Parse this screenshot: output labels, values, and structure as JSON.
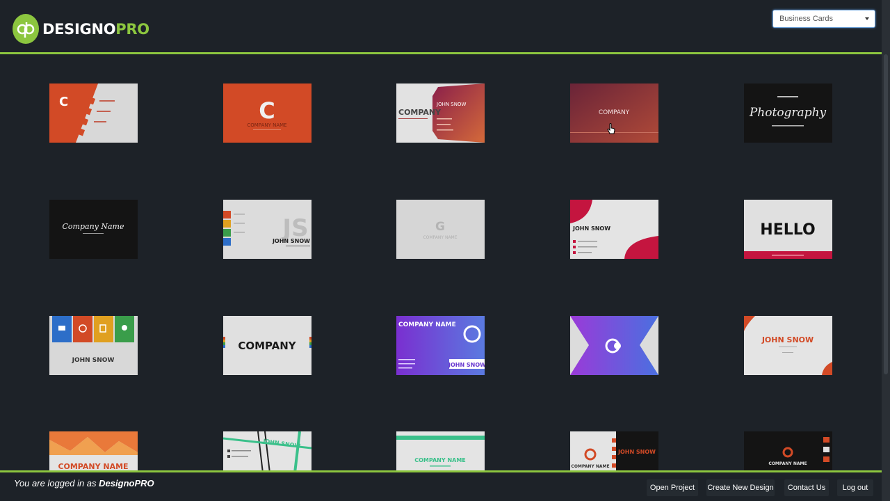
{
  "header": {
    "logo_part1": "DESIGNO",
    "logo_part2": "PRO",
    "category_select": {
      "selected": "Business Cards"
    }
  },
  "templates": [
    {
      "id": "c-orange-diagonal",
      "text": "C"
    },
    {
      "id": "company-name-orange",
      "text": "C",
      "sub": "COMPANY NAME"
    },
    {
      "id": "company-john-snow-gradient",
      "text": "COMPANY",
      "sub": "JOHN SNOW"
    },
    {
      "id": "company-maroon",
      "text": "COMPANY"
    },
    {
      "id": "photography-dark",
      "text": "Photography"
    },
    {
      "id": "company-name-script-dark",
      "text": "Company Name"
    },
    {
      "id": "js-john-snow",
      "text": "JS",
      "sub": "JOHN SNOW"
    },
    {
      "id": "g-company-name",
      "text": "G",
      "sub": "COMPANY NAME"
    },
    {
      "id": "john-snow-red-blob",
      "text": "JOHN SNOW"
    },
    {
      "id": "hello-red-bar",
      "text": "HELLO"
    },
    {
      "id": "john-snow-tiles",
      "text": "JOHN SNOW"
    },
    {
      "id": "company-multicolor",
      "text": "COMPANY"
    },
    {
      "id": "company-name-purple",
      "text": "COMPANY NAME",
      "sub": "JOHN SNOW"
    },
    {
      "id": "purple-chevron-logo",
      "text": ""
    },
    {
      "id": "john-snow-orange-corners",
      "text": "JOHN SNOW"
    },
    {
      "id": "company-name-orange-mountains",
      "text": "COMPANY NAME"
    },
    {
      "id": "john-snow-green-lines",
      "text": "JOHN SNOW"
    },
    {
      "id": "company-name-teal",
      "text": "COMPANY NAME"
    },
    {
      "id": "company-name-john-snow-dark",
      "text": "COMPANY NAME",
      "sub": "JOHN SNOW"
    },
    {
      "id": "company-name-dark-orange",
      "text": "COMPANY NAME"
    }
  ],
  "footer": {
    "status_prefix": "You are logged in as",
    "username": "DesignoPRO",
    "buttons": {
      "open_project": "Open Project",
      "create_new_design": "Create New Design",
      "contact_us": "Contact Us",
      "log_out": "Log out"
    }
  },
  "colors": {
    "accent": "#8cc63f",
    "background": "#1d2228",
    "orange": "#d24a26",
    "purple": "#8a3fd8"
  }
}
